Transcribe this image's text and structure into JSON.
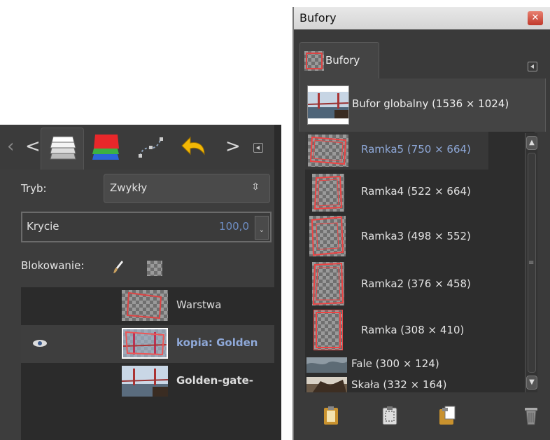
{
  "layers_dock": {
    "tabs": [
      {
        "icon": "layers-icon"
      },
      {
        "icon": "channels-icon"
      },
      {
        "icon": "paths-icon"
      },
      {
        "icon": "undo-history-icon"
      }
    ],
    "mode_label": "Tryb:",
    "mode_value": "Zwykły",
    "opacity_label": "Krycie",
    "opacity_value": "100,0",
    "lock_label": "Blokowanie:",
    "layers": [
      {
        "name": "Warstwa",
        "visible": false,
        "selected": false
      },
      {
        "name": "kopia: Golden",
        "visible": true,
        "selected": true
      },
      {
        "name": "Golden-gate-",
        "visible": false,
        "selected": false
      }
    ]
  },
  "buffers_window": {
    "title": "Bufory",
    "close_icon": "close-icon",
    "tab_label": "Bufory",
    "global_buffer": "Bufor globalny (1536 × 1024)",
    "buffers": [
      {
        "name": "Ramka5 (750 × 664)",
        "selected": true
      },
      {
        "name": "Ramka4 (522 × 664)",
        "selected": false
      },
      {
        "name": "Ramka3 (498 × 552)",
        "selected": false
      },
      {
        "name": "Ramka2 (376 × 458)",
        "selected": false
      },
      {
        "name": "Ramka (308 × 410)",
        "selected": false
      },
      {
        "name": "Fale (300 × 124)",
        "selected": false
      },
      {
        "name": "Skała (332 × 164)",
        "selected": false
      }
    ],
    "toolbar": [
      "paste-icon",
      "paste-into-icon",
      "paste-as-new-icon",
      "delete-buffer-icon"
    ]
  }
}
